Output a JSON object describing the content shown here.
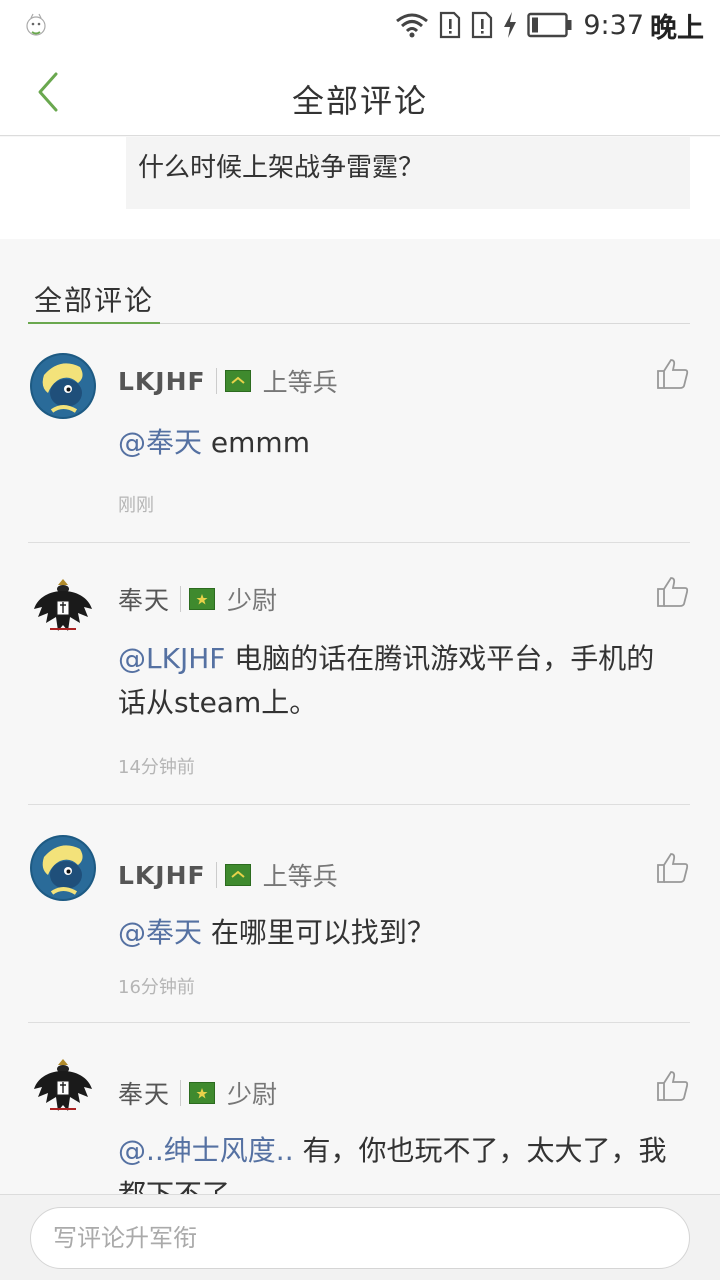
{
  "status_bar": {
    "time": "9:37",
    "period": "晚上",
    "icons": [
      "app-notification-icon",
      "wifi-icon",
      "sim-alert-icon",
      "sim-alert-icon",
      "charging-icon",
      "battery-icon"
    ]
  },
  "header": {
    "title": "全部评论",
    "back_icon": "chevron-left-icon"
  },
  "post": {
    "text": "什么时候上架战争雷霆？"
  },
  "section": {
    "tab_label": "全部评论"
  },
  "comments": [
    {
      "username": "LKJHF",
      "rank": "上等兵",
      "rank_icon": "chevron-rank-icon",
      "mention": "@奉天",
      "text": " emmm",
      "time": "刚刚"
    },
    {
      "username": "奉天",
      "rank": "少尉",
      "rank_icon": "star-rank-icon",
      "mention": "@LKJHF",
      "text": " 电脑的话在腾讯游戏平台，手机的话从steam上。",
      "time": "14分钟前"
    },
    {
      "username": "LKJHF",
      "rank": "上等兵",
      "rank_icon": "chevron-rank-icon",
      "mention": "@奉天",
      "text": " 在哪里可以找到？",
      "time": "16分钟前"
    },
    {
      "username": "奉天",
      "rank": "少尉",
      "rank_icon": "star-rank-icon",
      "mention": "@..绅士风度..",
      "text": " 有，你也玩不了，太大了，我都下不了",
      "time": ""
    }
  ],
  "input": {
    "placeholder": "写评论升军衔"
  },
  "colors": {
    "accent_green": "#6aa84f",
    "mention_blue": "#5571a2",
    "rank_green": "#3f8a2e"
  }
}
